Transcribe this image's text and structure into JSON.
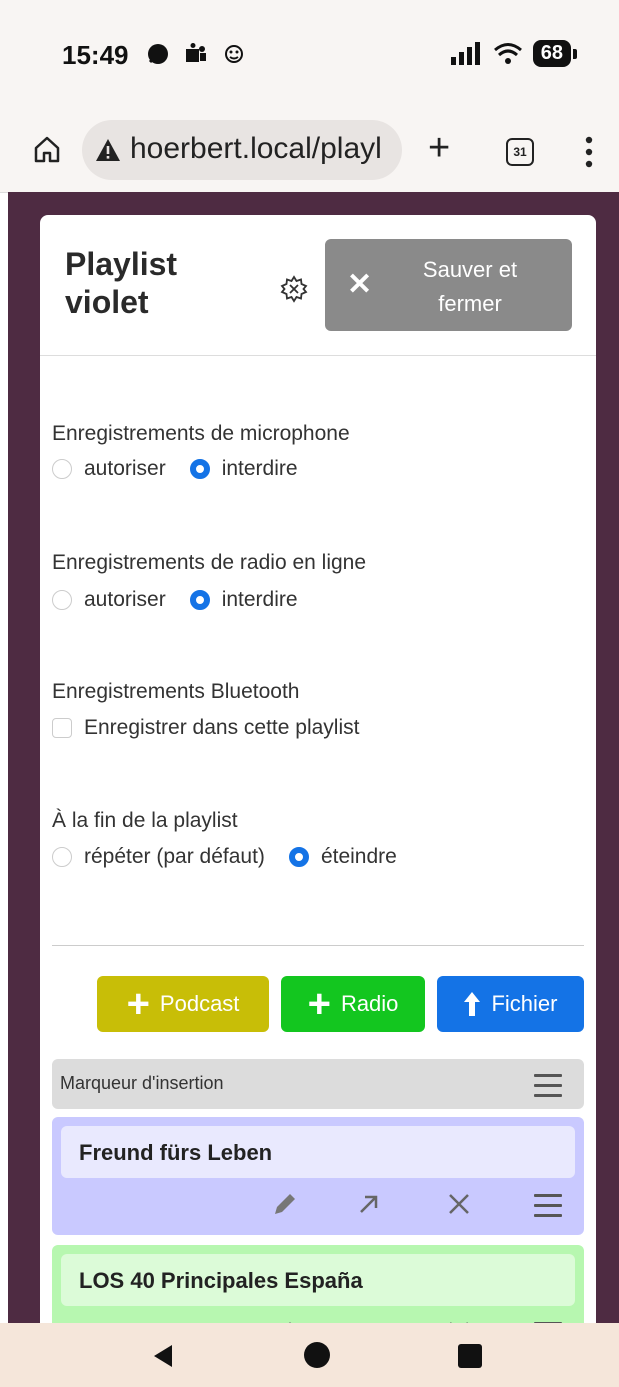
{
  "status_bar": {
    "time": "15:49",
    "left_icons": [
      "signal-app-icon",
      "teams-icon",
      "custom-app-icon"
    ],
    "right_icons": [
      "cell-signal-icon",
      "wifi-icon"
    ],
    "battery": "68"
  },
  "browser": {
    "url": "hoerbert.local/playl",
    "tab_count": "31",
    "icons": [
      "home-icon",
      "not-secure-icon",
      "new-tab-icon",
      "tab-switcher-icon",
      "menu-icon"
    ]
  },
  "header": {
    "title_line1": "Playlist",
    "title_line2": "violet",
    "settings_icon": "gear-icon",
    "save_close_label": "Sauver et\nfermer",
    "save_close_icon": "close-icon"
  },
  "sections": {
    "mic": {
      "title": "Enregistrements de microphone",
      "options": [
        {
          "label": "autoriser",
          "selected": false
        },
        {
          "label": "interdire",
          "selected": true
        }
      ]
    },
    "radio": {
      "title": "Enregistrements de radio en ligne",
      "options": [
        {
          "label": "autoriser",
          "selected": false
        },
        {
          "label": "interdire",
          "selected": true
        }
      ]
    },
    "bluetooth": {
      "title": "Enregistrements Bluetooth",
      "checkbox_label": "Enregistrer dans cette playlist",
      "checked": false
    },
    "end": {
      "title": "À la fin de la playlist",
      "options": [
        {
          "label": "répéter (par défaut)",
          "selected": false
        },
        {
          "label": "éteindre",
          "selected": true
        }
      ]
    }
  },
  "add_buttons": {
    "podcast": "Podcast",
    "radio": "Radio",
    "file": "Fichier",
    "colors": {
      "podcast": "#c8be07",
      "radio": "#13c61f",
      "file": "#1473e6"
    }
  },
  "insert_marker": {
    "label": "Marqueur d'insertion"
  },
  "items": [
    {
      "title": "Freund fürs Leben",
      "color": "#c9c9ff",
      "tools": [
        "edit-icon",
        "move-icon",
        "delete-icon",
        "drag-handle-icon"
      ]
    },
    {
      "title": "LOS 40 Principales España",
      "color": "#b7f7b0",
      "tools": [
        "edit-icon",
        "move-icon",
        "delete-icon",
        "drag-handle-icon"
      ]
    }
  ],
  "nav": [
    "back-icon",
    "home-icon",
    "recents-icon"
  ]
}
